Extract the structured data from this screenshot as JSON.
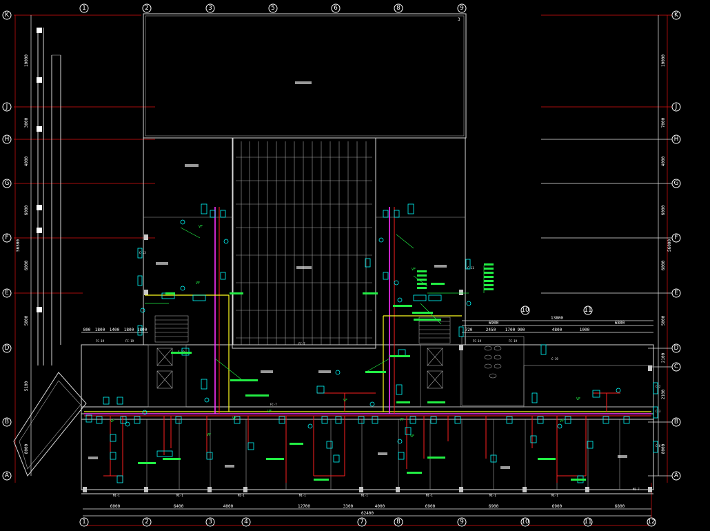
{
  "drawing": {
    "sheet_number": "3",
    "grid_columns_top": [
      "1",
      "2",
      "3",
      "5",
      "6",
      "8",
      "9"
    ],
    "grid_columns_bottom": [
      "1",
      "2",
      "3",
      "4",
      "7",
      "8",
      "9",
      "10",
      "11",
      "12"
    ],
    "grid_columns_mid": [
      "10",
      "11"
    ],
    "grid_rows_left": [
      "K",
      "J",
      "H",
      "G",
      "F",
      "E",
      "D",
      "B",
      "A"
    ],
    "grid_rows_right": [
      "K",
      "J",
      "H",
      "G",
      "F",
      "E",
      "D",
      "C",
      "B",
      "A"
    ],
    "bottom_dims": [
      "6000",
      "6400",
      "4000",
      "12700",
      "3300",
      "4000",
      "6900",
      "6900",
      "6900",
      "6800"
    ],
    "bottom_total": "62400",
    "mid_dims_left": [
      "800",
      "1800",
      "1400",
      "1800",
      "1800"
    ],
    "mid_dims_right": [
      "6900",
      "6800",
      "720",
      "2450",
      "1700",
      "900",
      "4800",
      "1000"
    ],
    "mid_total_right": "13800",
    "left_dims_vertical": [
      "10000",
      "3000",
      "4000",
      "6000",
      "6000",
      "5000",
      "5100",
      "8000"
    ],
    "left_total_vertical": "56500",
    "right_dims_vertical": [
      "10000",
      "7000",
      "4000",
      "6000",
      "6000",
      "5000",
      "2100",
      "2100",
      "8000"
    ],
    "right_total_vertical": "56000",
    "tags": [
      "M1-1",
      "M1-1",
      "M1-1",
      "M1-1",
      "M1-1",
      "M1-1",
      "M1-1",
      "M1-1",
      "M1-7",
      "FC-7",
      "FC-7",
      "FC-19",
      "FC-19",
      "FC-19",
      "FC-19",
      "C-19",
      "C-19",
      "C-2",
      "C-3",
      "C-6",
      "C-11",
      "C-13"
    ],
    "riser_labels": [
      "VF",
      "VF",
      "VF",
      "VF",
      "VF",
      "VF",
      "VF",
      "VF",
      "VF",
      "VF",
      "VF",
      "VF"
    ]
  }
}
